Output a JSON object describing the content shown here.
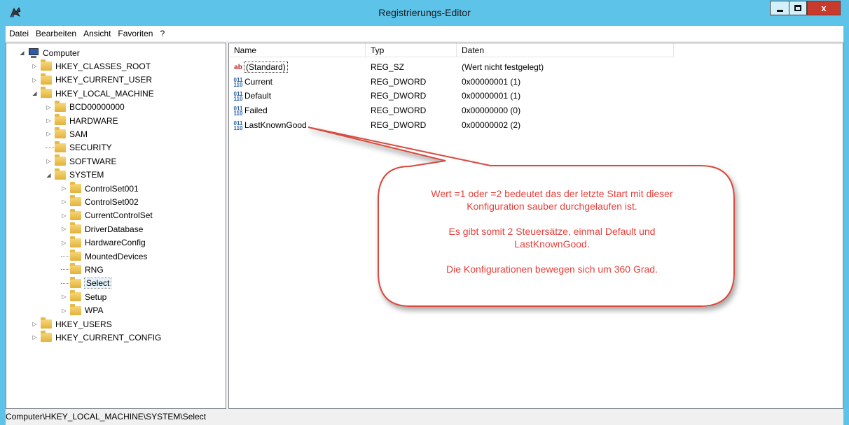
{
  "window": {
    "title": "Registrierungs-Editor",
    "close_label": "x",
    "icon": "regedit-icon"
  },
  "menu": [
    "Datei",
    "Bearbeiten",
    "Ansicht",
    "Favoriten",
    "?"
  ],
  "tree": [
    {
      "label": "Computer",
      "level": 0,
      "expander": "open",
      "icon": "computer-icon"
    },
    {
      "label": "HKEY_CLASSES_ROOT",
      "level": 1,
      "expander": "closed",
      "icon": "folder-icon"
    },
    {
      "label": "HKEY_CURRENT_USER",
      "level": 1,
      "expander": "closed",
      "icon": "folder-icon"
    },
    {
      "label": "HKEY_LOCAL_MACHINE",
      "level": 1,
      "expander": "open",
      "icon": "folder-icon"
    },
    {
      "label": "BCD00000000",
      "level": 2,
      "expander": "closed",
      "icon": "folder-icon"
    },
    {
      "label": "HARDWARE",
      "level": 2,
      "expander": "closed",
      "icon": "folder-icon"
    },
    {
      "label": "SAM",
      "level": 2,
      "expander": "closed",
      "icon": "folder-icon"
    },
    {
      "label": "SECURITY",
      "level": 2,
      "expander": "none",
      "icon": "folder-icon"
    },
    {
      "label": "SOFTWARE",
      "level": 2,
      "expander": "closed",
      "icon": "folder-icon"
    },
    {
      "label": "SYSTEM",
      "level": 2,
      "expander": "open",
      "icon": "folder-icon"
    },
    {
      "label": "ControlSet001",
      "level": 3,
      "expander": "closed",
      "icon": "folder-icon"
    },
    {
      "label": "ControlSet002",
      "level": 3,
      "expander": "closed",
      "icon": "folder-icon"
    },
    {
      "label": "CurrentControlSet",
      "level": 3,
      "expander": "closed",
      "icon": "folder-icon"
    },
    {
      "label": "DriverDatabase",
      "level": 3,
      "expander": "closed",
      "icon": "folder-icon"
    },
    {
      "label": "HardwareConfig",
      "level": 3,
      "expander": "closed",
      "icon": "folder-icon"
    },
    {
      "label": "MountedDevices",
      "level": 3,
      "expander": "none",
      "icon": "folder-icon"
    },
    {
      "label": "RNG",
      "level": 3,
      "expander": "none",
      "icon": "folder-icon"
    },
    {
      "label": "Select",
      "level": 3,
      "expander": "none",
      "icon": "folder-icon",
      "selected": true
    },
    {
      "label": "Setup",
      "level": 3,
      "expander": "closed",
      "icon": "folder-icon"
    },
    {
      "label": "WPA",
      "level": 3,
      "expander": "closed",
      "icon": "folder-icon"
    },
    {
      "label": "HKEY_USERS",
      "level": 1,
      "expander": "closed",
      "icon": "folder-icon"
    },
    {
      "label": "HKEY_CURRENT_CONFIG",
      "level": 1,
      "expander": "closed",
      "icon": "folder-icon"
    }
  ],
  "columns": {
    "name": "Name",
    "type": "Typ",
    "data": "Daten"
  },
  "values": [
    {
      "name": "(Standard)",
      "type": "REG_SZ",
      "data": "(Wert nicht festgelegt)",
      "icon": "string-value-icon"
    },
    {
      "name": "Current",
      "type": "REG_DWORD",
      "data": "0x00000001 (1)",
      "icon": "dword-value-icon"
    },
    {
      "name": "Default",
      "type": "REG_DWORD",
      "data": "0x00000001 (1)",
      "icon": "dword-value-icon"
    },
    {
      "name": "Failed",
      "type": "REG_DWORD",
      "data": "0x00000000 (0)",
      "icon": "dword-value-icon"
    },
    {
      "name": "LastKnownGood",
      "type": "REG_DWORD",
      "data": "0x00000002 (2)",
      "icon": "dword-value-icon"
    }
  ],
  "callout": {
    "line1": "Wert =1 oder =2 bedeutet das der letzte Start mit dieser",
    "line2": "Konfiguration sauber durchgelaufen ist.",
    "line3": "Es gibt somit 2 Steuersätze, einmal Default und",
    "line4": "LastKnownGood.",
    "line5": "Die Konfigurationen bewegen sich um 360 Grad.",
    "color": "#e8403c"
  },
  "status": {
    "path": "Computer\\HKEY_LOCAL_MACHINE\\SYSTEM\\Select"
  },
  "colors": {
    "titlebar": "#5ec3e9",
    "close_button": "#c73b2d"
  }
}
